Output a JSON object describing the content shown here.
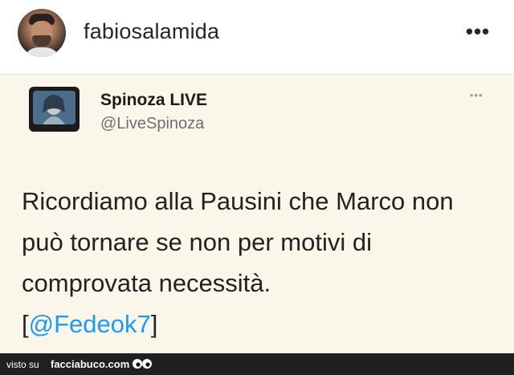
{
  "header": {
    "username": "fabiosalamida",
    "more_label": "•••"
  },
  "tweet": {
    "display_name": "Spinoza LIVE",
    "handle": "@LiveSpinoza",
    "more_label": "•••",
    "lines": [
      "Ricordiamo alla Pausini che Marco non",
      "può tornare se non per motivi di",
      "comprovata necessità."
    ],
    "mention_open": "[",
    "mention": "@Fedeok7",
    "mention_close": "]"
  },
  "footer": {
    "visto_su": "visto su",
    "site": "facciabuco.com"
  },
  "colors": {
    "card_bg": "#faf6ea",
    "mention": "#1d9bf0",
    "footer_bg": "#202020"
  }
}
